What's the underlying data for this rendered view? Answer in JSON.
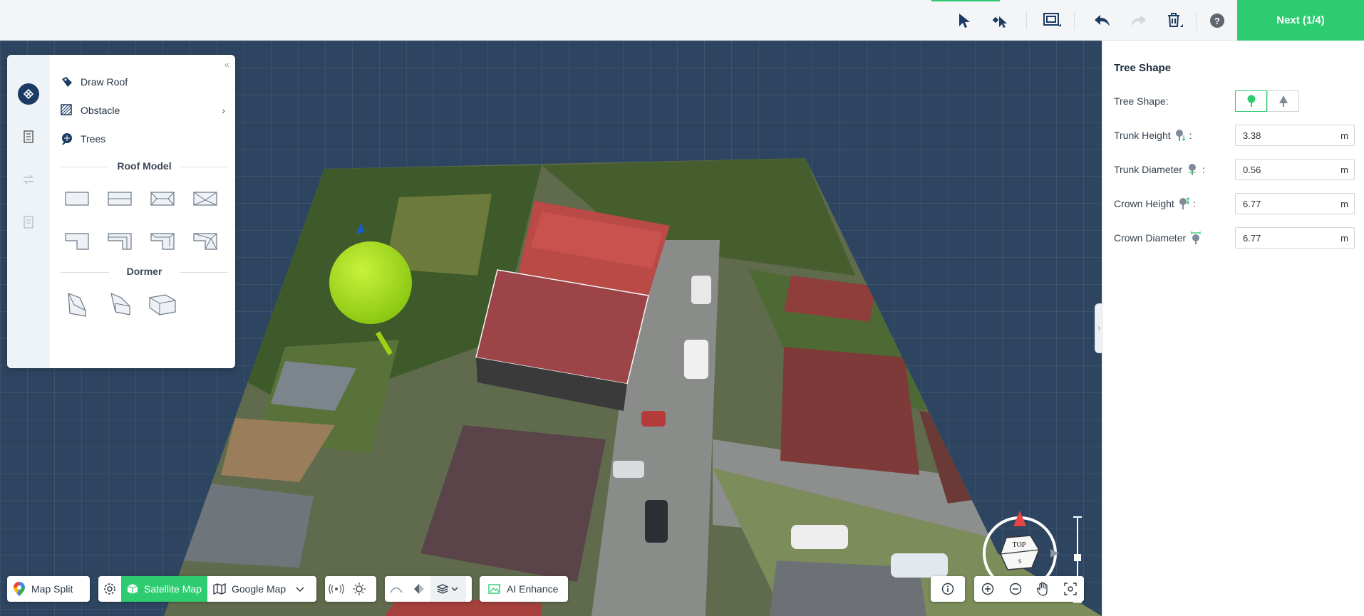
{
  "topbar": {
    "next_label": "Next (1/4)",
    "tools": [
      "select-icon",
      "multi-select-icon",
      "screenshot-frame-icon",
      "undo-icon",
      "redo-icon",
      "delete-icon",
      "help-icon"
    ],
    "help_glyph": "?"
  },
  "left_panel": {
    "items": [
      {
        "label": "Draw Roof",
        "icon": "draw-roof-icon"
      },
      {
        "label": "Obstacle",
        "icon": "obstacle-icon"
      },
      {
        "label": "Trees",
        "icon": "trees-icon"
      }
    ],
    "roof_model_title": "Roof Model",
    "dormer_title": "Dormer",
    "collapse_glyph": "«",
    "obstacle_chevron": "›"
  },
  "right_panel": {
    "title": "Tree Shape",
    "tree_shape_label": "Tree Shape:",
    "fields": [
      {
        "label": "Trunk Height",
        "suffix": ":",
        "value": "3.38",
        "unit": "m"
      },
      {
        "label": "Trunk Diameter",
        "suffix": ":",
        "value": "0.56",
        "unit": "m"
      },
      {
        "label": "Crown Height",
        "suffix": ":",
        "value": "6.77",
        "unit": "m"
      },
      {
        "label": "Crown Diameter",
        "suffix": "",
        "value": "6.77",
        "unit": "m"
      }
    ],
    "handle_glyph": "›"
  },
  "bottom_bar": {
    "map_split": "Map Split",
    "satellite_map": "Satellite Map",
    "google_map": "Google Map",
    "ai_enhance": "AI Enhance"
  },
  "compass": {
    "top_label": "TOP",
    "south_label": "S"
  },
  "colors": {
    "accent": "#2ecc71",
    "navy": "#1c3b63",
    "tree": "#a6e01c",
    "grid_bg": "#2d4560"
  }
}
